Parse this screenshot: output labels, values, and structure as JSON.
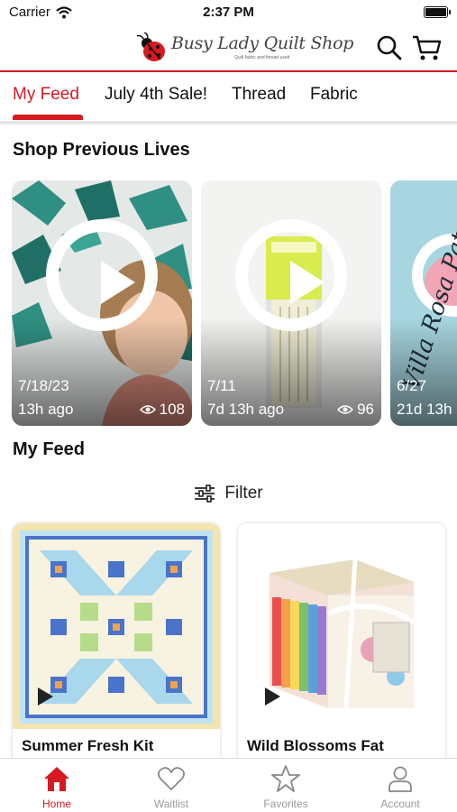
{
  "status_bar": {
    "carrier": "Carrier",
    "time": "2:37 PM"
  },
  "header": {
    "logo_title": "Busy Lady Quilt Shop",
    "logo_subtitle": "Quilt fabric and thread used",
    "brand_color": "#d71920"
  },
  "tabs": [
    {
      "label": "My Feed",
      "active": true
    },
    {
      "label": "July 4th Sale!",
      "active": false
    },
    {
      "label": "Thread",
      "active": false
    },
    {
      "label": "Fabric",
      "active": false
    }
  ],
  "previous_lives": {
    "title": "Shop Previous Lives",
    "cards": [
      {
        "date": "7/18/23",
        "ago": "13h ago",
        "views": "108"
      },
      {
        "date": "7/11",
        "ago": "7d 13h ago",
        "views": "96"
      },
      {
        "date": "6/27",
        "ago": "21d 13h",
        "views": ""
      }
    ],
    "card3_overlay": "Villa Rosa Pat"
  },
  "feed": {
    "title": "My Feed",
    "filter_label": "Filter",
    "products": [
      {
        "name": "Summer Fresh Kit"
      },
      {
        "name": "Wild Blossoms Fat"
      }
    ]
  },
  "bottom_nav": [
    {
      "label": "Home",
      "icon": "home-icon",
      "active": true
    },
    {
      "label": "Waitlist",
      "icon": "heart-icon",
      "active": false
    },
    {
      "label": "Favorites",
      "icon": "star-icon",
      "active": false
    },
    {
      "label": "Account",
      "icon": "person-icon",
      "active": false
    }
  ]
}
